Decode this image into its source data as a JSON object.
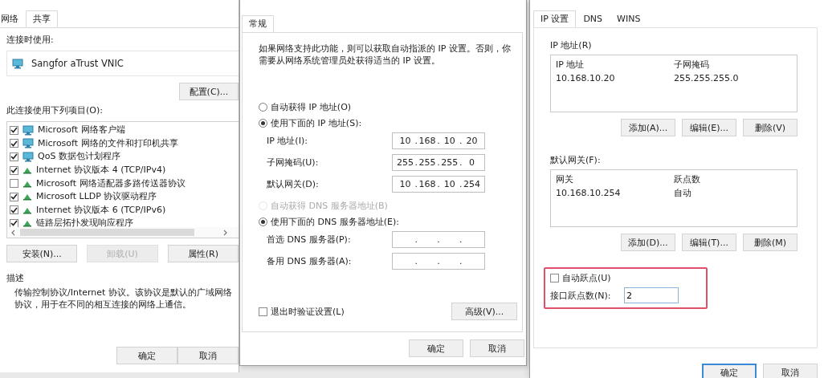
{
  "left_dialog": {
    "tabs": [
      {
        "label": "网络",
        "selected": false
      },
      {
        "label": "共享",
        "selected": true
      }
    ],
    "connect_using_label": "连接时使用:",
    "adapter": "Sangfor aTrust VNIC",
    "configure_button": "配置(C)...",
    "items_label": "此连接使用下列项目(O):",
    "items": [
      {
        "label": "Microsoft 网络客户端",
        "checked": true,
        "kind": "network"
      },
      {
        "label": "Microsoft 网络的文件和打印机共享",
        "checked": true,
        "kind": "network"
      },
      {
        "label": "QoS 数据包计划程序",
        "checked": true,
        "kind": "network"
      },
      {
        "label": "Internet 协议版本 4 (TCP/IPv4)",
        "checked": true,
        "kind": "protocol"
      },
      {
        "label": "Microsoft 网络适配器多路传送器协议",
        "checked": false,
        "kind": "protocol"
      },
      {
        "label": "Microsoft LLDP 协议驱动程序",
        "checked": true,
        "kind": "protocol"
      },
      {
        "label": "Internet 协议版本 6 (TCP/IPv6)",
        "checked": true,
        "kind": "protocol"
      },
      {
        "label": "链路层拓扑发现响应程序",
        "checked": true,
        "kind": "protocol"
      }
    ],
    "item_buttons": [
      {
        "label": "安装(N)...",
        "disabled": false
      },
      {
        "label": "卸载(U)",
        "disabled": true
      },
      {
        "label": "属性(R)",
        "disabled": false
      }
    ],
    "description_title": "描述",
    "description": "传输控制协议/Internet 协议。该协议是默认的广域网络协议，用于在不同的相互连接的网络上通信。",
    "buttons": [
      "确定",
      "取消"
    ]
  },
  "ipv4_dialog": {
    "tabs": [
      {
        "label": "常规",
        "selected": true
      }
    ],
    "intro": "如果网络支持此功能，则可以获取自动指派的 IP 设置。否则，你需要从网络系统管理员处获得适当的 IP 设置。",
    "ip_radios": [
      {
        "label": "自动获得 IP 地址(O)",
        "selected": false,
        "disabled": false
      },
      {
        "label": "使用下面的 IP 地址(S):",
        "selected": true,
        "disabled": false
      }
    ],
    "octet_separator": ".",
    "ip_fields": [
      {
        "label": "IP 地址(I):",
        "octets": [
          "10",
          "168",
          "10",
          "20"
        ]
      },
      {
        "label": "子网掩码(U):",
        "octets": [
          "255",
          "255",
          "255",
          "0"
        ]
      },
      {
        "label": "默认网关(D):",
        "octets": [
          "10",
          "168",
          "10",
          "254"
        ]
      }
    ],
    "dns_radios": [
      {
        "label": "自动获得 DNS 服务器地址(B)",
        "selected": false,
        "disabled": true
      },
      {
        "label": "使用下面的 DNS 服务器地址(E):",
        "selected": true,
        "disabled": false
      }
    ],
    "dns_fields": [
      {
        "label": "首选 DNS 服务器(P):"
      },
      {
        "label": "备用 DNS 服务器(A):"
      }
    ],
    "validate_checkbox": {
      "label": "退出时验证设置(L)",
      "checked": false
    },
    "advanced_button": "高级(V)...",
    "buttons": [
      "确定",
      "取消"
    ]
  },
  "advanced_dialog": {
    "tabs": [
      {
        "label": "IP 设置",
        "selected": true
      },
      {
        "label": "DNS",
        "selected": false
      },
      {
        "label": "WINS",
        "selected": false
      }
    ],
    "ip_section": {
      "title": "IP 地址(R)",
      "columns": [
        "IP 地址",
        "子网掩码"
      ],
      "rows": [
        [
          "10.168.10.20",
          "255.255.255.0"
        ]
      ],
      "buttons": [
        "添加(A)...",
        "编辑(E)...",
        "删除(V)"
      ]
    },
    "gateway_section": {
      "title": "默认网关(F):",
      "columns": [
        "网关",
        "跃点数"
      ],
      "rows": [
        [
          "10.168.10.254",
          "自动"
        ]
      ],
      "buttons": [
        "添加(D)...",
        "编辑(T)...",
        "删除(M)"
      ]
    },
    "automatic_metric": {
      "label": "自动跃点(U)",
      "checked": false
    },
    "interface_metric": {
      "label": "接口跃点数(N):",
      "value": "2"
    },
    "buttons": [
      {
        "label": "确定",
        "default": true
      },
      {
        "label": "取消",
        "default": false
      }
    ]
  }
}
